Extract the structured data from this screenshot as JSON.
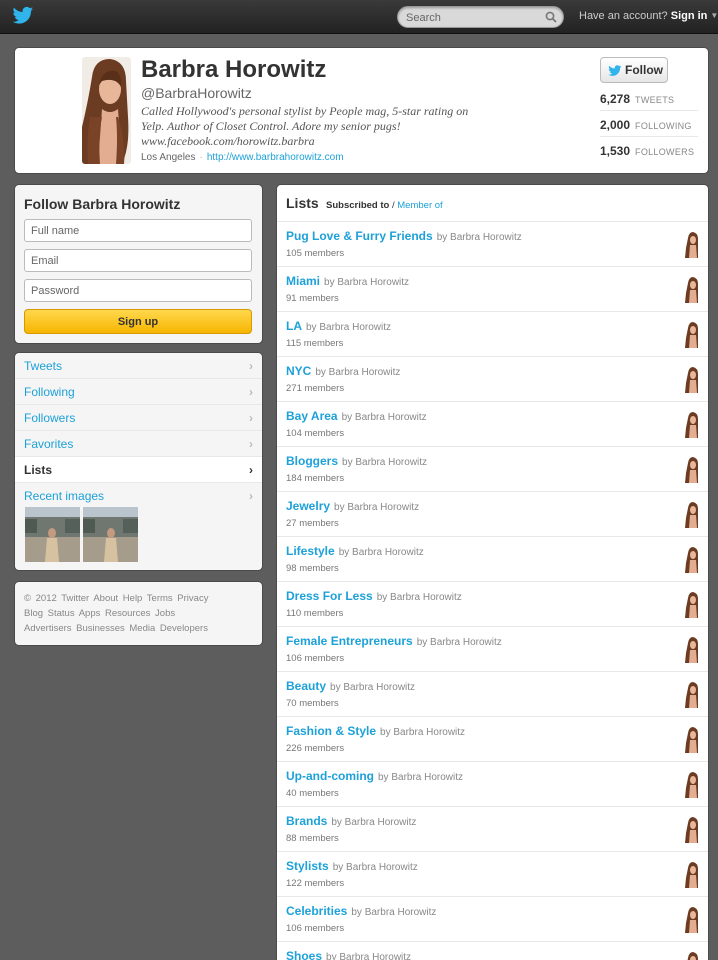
{
  "topbar": {
    "search_placeholder": "Search",
    "account_text": "Have an account?",
    "signin_label": "Sign in"
  },
  "profile": {
    "name": "Barbra Horowitz",
    "handle": "@BarbraHorowitz",
    "bio": "Called Hollywood's personal stylist by People mag, 5-star rating on Yelp. Author of Closet Control. Adore my senior pugs! www.facebook.com/horowitz.barbra",
    "location": "Los Angeles",
    "url": "http://www.barbrahorowitz.com",
    "follow_label": "Follow",
    "stats": [
      {
        "value": "6,278",
        "label": "TWEETS"
      },
      {
        "value": "2,000",
        "label": "FOLLOWING"
      },
      {
        "value": "1,530",
        "label": "FOLLOWERS"
      }
    ]
  },
  "signup": {
    "title": "Follow Barbra Horowitz",
    "fullname_placeholder": "Full name",
    "email_placeholder": "Email",
    "password_placeholder": "Password",
    "button_label": "Sign up"
  },
  "nav": {
    "items": [
      {
        "label": "Tweets"
      },
      {
        "label": "Following"
      },
      {
        "label": "Followers"
      },
      {
        "label": "Favorites"
      },
      {
        "label": "Lists"
      },
      {
        "label": "Recent images"
      }
    ]
  },
  "footer": {
    "line1": "© 2012 Twitter  About  Help  Terms  Privacy",
    "line2": "Blog  Status  Apps  Resources  Jobs",
    "line3": "Advertisers  Businesses  Media  Developers"
  },
  "lists": {
    "title": "Lists",
    "subscribed_label": "Subscribed to",
    "member_of_label": "Member of",
    "by_text": "by Barbra Horowitz",
    "items": [
      {
        "name": "Pug Love & Furry Friends",
        "members": "105 members"
      },
      {
        "name": "Miami",
        "members": "91 members"
      },
      {
        "name": "LA",
        "members": "115 members"
      },
      {
        "name": "NYC",
        "members": "271 members"
      },
      {
        "name": "Bay Area",
        "members": "104 members"
      },
      {
        "name": "Bloggers",
        "members": "184 members"
      },
      {
        "name": "Jewelry",
        "members": "27 members"
      },
      {
        "name": "Lifestyle",
        "members": "98 members"
      },
      {
        "name": "Dress For Less",
        "members": "110 members"
      },
      {
        "name": "Female Entrepreneurs",
        "members": "106 members"
      },
      {
        "name": "Beauty",
        "members": "70 members"
      },
      {
        "name": "Fashion & Style",
        "members": "226 members"
      },
      {
        "name": "Up-and-coming",
        "members": "40 members"
      },
      {
        "name": "Brands",
        "members": "88 members"
      },
      {
        "name": "Stylists",
        "members": "122 members"
      },
      {
        "name": "Celebrities",
        "members": "106 members"
      },
      {
        "name": "Shoes",
        "members": ""
      }
    ]
  },
  "colors": {
    "link": "#1da1d8",
    "background": "#5d5d5d",
    "signup_button": "#f7b500"
  }
}
